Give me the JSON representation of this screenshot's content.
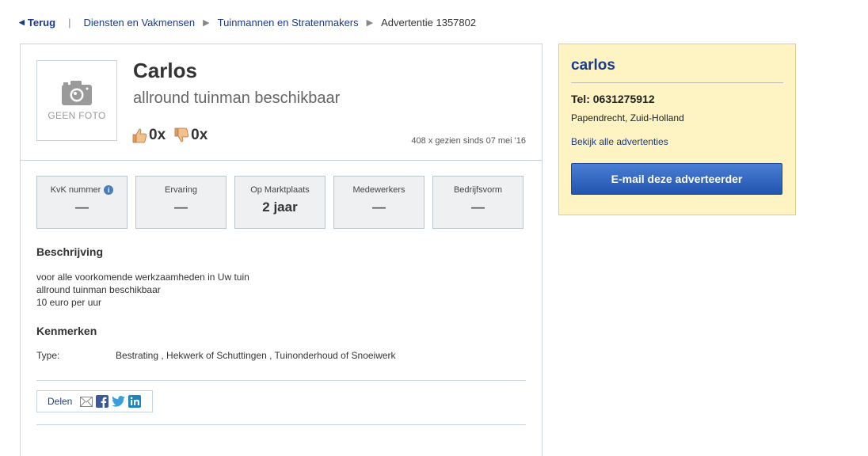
{
  "breadcrumb": {
    "back": "Terug",
    "separator": "|",
    "items": [
      "Diensten en Vakmensen",
      "Tuinmannen en Stratenmakers"
    ],
    "current": "Advertentie 1357802"
  },
  "ad": {
    "photo_label": "GEEN FOTO",
    "name": "Carlos",
    "subtitle": "allround tuinman beschikbaar",
    "votes_up": "0x",
    "votes_down": "0x",
    "views": "408 x gezien sinds 07 mei '16"
  },
  "stats": [
    {
      "title": "KvK nummer",
      "value": "—",
      "info": "i"
    },
    {
      "title": "Ervaring",
      "value": "—"
    },
    {
      "title": "Op Marktplaats",
      "value": "2 jaar"
    },
    {
      "title": "Medewerkers",
      "value": "—"
    },
    {
      "title": "Bedrijfsvorm",
      "value": "—"
    }
  ],
  "description": {
    "heading": "Beschrijving",
    "lines": [
      "voor alle voorkomende werkzaamheden in Uw tuin",
      "allround tuinman beschikbaar",
      "10 euro per uur"
    ]
  },
  "features": {
    "heading": "Kenmerken",
    "type_label": "Type:",
    "type_value": "Bestrating , Hekwerk of Schuttingen , Tuinonderhoud of Snoeiwerk"
  },
  "share": {
    "label": "Delen",
    "icons": [
      "email-icon",
      "facebook-icon",
      "twitter-icon",
      "linkedin-icon"
    ]
  },
  "seller": {
    "name": "carlos",
    "phone": "Tel: 0631275912",
    "location": "Papendrecht, Zuid-Holland",
    "all_ads_link": "Bekijk alle advertenties",
    "email_button": "E-mail deze adverteerder"
  },
  "colors": {
    "link": "#1a3a8a",
    "sidebar_bg": "#fdf3c3",
    "button": "#2c5fbf"
  }
}
